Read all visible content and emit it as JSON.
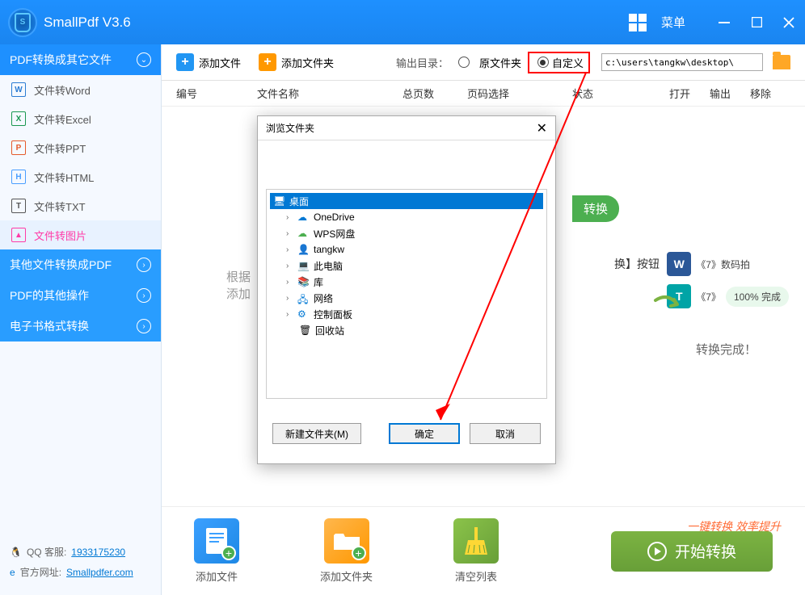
{
  "app": {
    "title": "SmallPdf V3.6",
    "menu_label": "菜单"
  },
  "sidebar": {
    "cat1": "PDF转换成其它文件",
    "items": [
      {
        "label": "文件转Word"
      },
      {
        "label": "文件转Excel"
      },
      {
        "label": "文件转PPT"
      },
      {
        "label": "文件转HTML"
      },
      {
        "label": "文件转TXT"
      },
      {
        "label": "文件转图片"
      }
    ],
    "cat2": "其他文件转换成PDF",
    "cat3": "PDF的其他操作",
    "cat4": "电子书格式转换",
    "qq_label": "QQ 客服:",
    "qq_number": "1933175230",
    "site_label": "官方网址:",
    "site_url": "Smallpdfer.com"
  },
  "toolbar": {
    "add_file": "添加文件",
    "add_folder": "添加文件夹",
    "output_label": "输出目录：",
    "radio_source": "原文件夹",
    "radio_custom": "自定义",
    "path": "c:\\users\\tangkw\\desktop\\"
  },
  "table": {
    "h1": "编号",
    "h2": "文件名称",
    "h3": "总页数",
    "h4": "页码选择",
    "h5": "状态",
    "h6": "打开",
    "h7": "输出",
    "h8": "移除"
  },
  "bg": {
    "hint1": "根据",
    "hint2": "添加",
    "convert_badge": "转换",
    "convert_hint": "换】按钮",
    "file1": "《7》数码拍",
    "file2": "《7》",
    "progress": "100%  完成",
    "done": "转换完成！"
  },
  "bottom": {
    "add_file": "添加文件",
    "add_folder": "添加文件夹",
    "clear": "清空列表",
    "tagline": "一键转换  效率提升",
    "start": "开始转换"
  },
  "dialog": {
    "title": "浏览文件夹",
    "tree": {
      "root": "桌面",
      "items": [
        "OneDrive",
        "WPS网盘",
        "tangkw",
        "此电脑",
        "库",
        "网络",
        "控制面板",
        "回收站"
      ]
    },
    "new_folder": "新建文件夹(M)",
    "ok": "确定",
    "cancel": "取消"
  }
}
